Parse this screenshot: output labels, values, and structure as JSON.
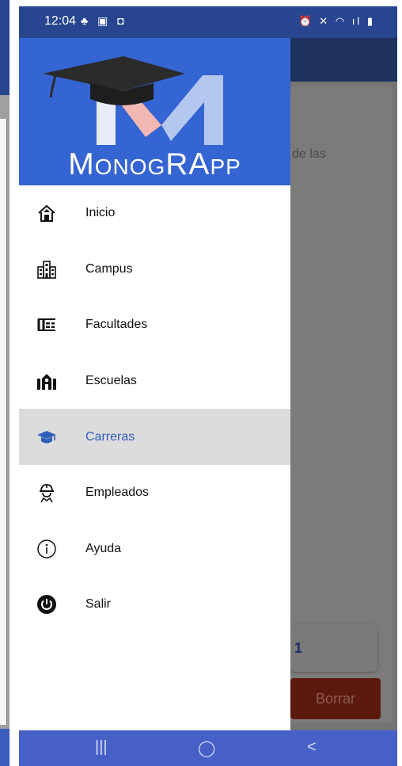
{
  "status_bar": {
    "time": "12:04",
    "left_icons": "♣ ▣ ◘",
    "right_icons": "⏰ ✕ ◠ ıl ▮"
  },
  "background_app": {
    "partial_text": "de las",
    "field_value": "1",
    "delete_button": "Borrar"
  },
  "drawer": {
    "logo": {
      "first_letter": "M",
      "text_rest": "ONOG",
      "text_rest2": "RA",
      "text_rest3": "PP",
      "colors": {
        "m_left": "#e8ecf6",
        "m_middle": "#f2b7b3",
        "m_right": "#b4c8ef",
        "cap": "#2b2b2b"
      }
    },
    "header_color": "#3565d2",
    "menu": [
      {
        "label": "Inicio",
        "icon": "home-icon"
      },
      {
        "label": "Campus",
        "icon": "buildings-icon"
      },
      {
        "label": "Facultades",
        "icon": "faculty-icon"
      },
      {
        "label": "Escuelas",
        "icon": "school-icon"
      },
      {
        "label": "Carreras",
        "icon": "graduation-cap-icon",
        "selected": true
      },
      {
        "label": "Empleados",
        "icon": "worker-icon"
      },
      {
        "label": "Ayuda",
        "icon": "info-icon"
      },
      {
        "label": "Salir",
        "icon": "power-icon"
      }
    ]
  },
  "nav_bar": {
    "recents": "|||",
    "home": "◯",
    "back": "<"
  },
  "accent_color": "#2e5fb8"
}
